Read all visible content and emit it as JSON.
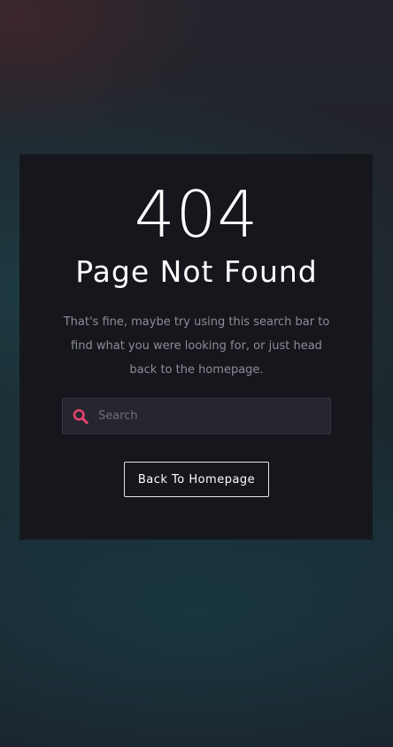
{
  "error": {
    "code": "404",
    "title": "Page Not Found",
    "description": "That's fine, maybe try using this search bar to find what you were looking for, or just head back to the homepage."
  },
  "search": {
    "placeholder": "Search",
    "value": "",
    "icon": "search-icon"
  },
  "actions": {
    "back_label": "Back To Homepage"
  },
  "colors": {
    "accent": "#e6436b",
    "card_background": "#16171d",
    "text_primary": "#ffffff",
    "text_muted": "#8c8d96"
  }
}
